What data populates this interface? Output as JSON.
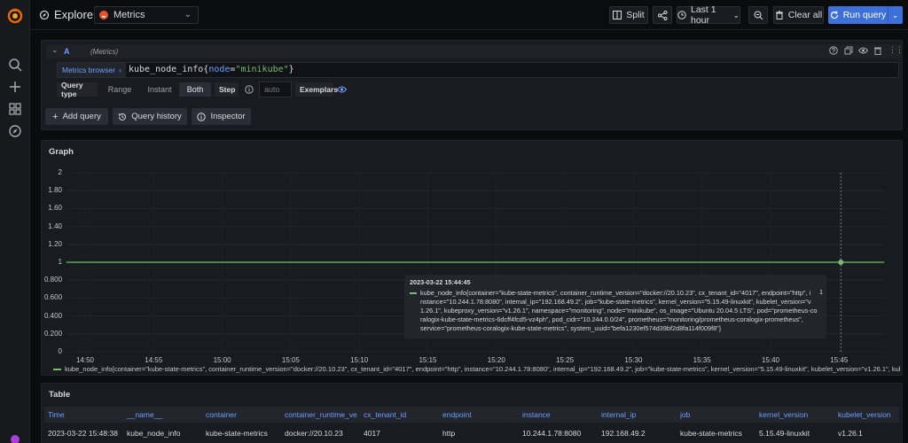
{
  "header": {
    "title": "Explore",
    "datasource": "Metrics",
    "split_label": "Split",
    "time_range": "Last 1 hour",
    "clear_all_label": "Clear all",
    "run_query_label": "Run query"
  },
  "query": {
    "ref": "A",
    "datasource_tag": "(Metrics)",
    "metrics_browser": "Metrics browser",
    "expr_metric": "kube_node_info",
    "expr_open": "{",
    "expr_label": "node",
    "expr_op": "=",
    "expr_value": "\"minikube\"",
    "expr_close": "}",
    "query_type_label": "Query type",
    "query_types": [
      "Range",
      "Instant",
      "Both"
    ],
    "selected_query_type": "Both",
    "step_label": "Step",
    "step_placeholder": "auto",
    "exemplars_label": "Exemplars"
  },
  "actions": {
    "add_query": "Add query",
    "query_history": "Query history",
    "inspector": "Inspector"
  },
  "graph": {
    "title": "Graph",
    "tooltip_time": "2023-03-22 15:44:45",
    "tooltip_line1": "kube_node_info{container=\"kube-state-metrics\", container_runtime_version=\"docker://20.10.23\", cx_tenant_id=\"4017\", endpoint=\"http\", i",
    "tooltip_line2": "nstance=\"10.244.1.78:8080\", internal_ip=\"192.168.49.2\", job=\"kube-state-metrics\", kernel_version=\"5.15.49-linuxkit\", kubelet_version=\"v",
    "tooltip_line3": "1.26.1\", kubeproxy_version=\"v1.26.1\", namespace=\"monitoring\", node=\"minikube\", os_image=\"Ubuntu 20.04.5 LTS\", pod=\"prometheus-co",
    "tooltip_line4": "ralogix-kube-state-metrics-6dcff4fcd5-vz4ph\", pod_cidr=\"10.244.0.0/24\", prometheus=\"monitoring/prometheus-coralogix-prometheus\",",
    "tooltip_line5": "service=\"prometheus-coralogix-kube-state-metrics\", system_uuid=\"befa1230ef574d39bf2d8fa114f009f8\"}",
    "tooltip_value": "1",
    "legend": "kube_node_info{container=\"kube-state-metrics\", container_runtime_version=\"docker://20.10.23\", cx_tenant_id=\"4017\", endpoint=\"http\", instance=\"10.244.1.78:8080\", internal_ip=\"192.168.49.2\", job=\"kube-state-metrics\", kernel_version=\"5.15.49-linuxkit\", kubelet_version=\"v1.26.1\", kubeproxy_version=\"v"
  },
  "chart_data": {
    "type": "line",
    "x": [
      "14:50",
      "14:55",
      "15:00",
      "15:05",
      "15:10",
      "15:15",
      "15:20",
      "15:25",
      "15:30",
      "15:35",
      "15:40",
      "15:45"
    ],
    "y_ticks": [
      "2",
      "1.80",
      "1.60",
      "1.40",
      "1.20",
      "1",
      "0.800",
      "0.600",
      "0.400",
      "0.200",
      "0"
    ],
    "ylim": [
      0,
      2
    ],
    "series": [
      {
        "name": "kube_node_info{container=\"kube-state-metrics\", ...}",
        "values": [
          1,
          1,
          1,
          1,
          1,
          1,
          1,
          1,
          1,
          1,
          1,
          1
        ],
        "color": "#73bf69"
      }
    ]
  },
  "table": {
    "title": "Table",
    "columns": [
      "Time",
      "__name__",
      "container",
      "container_runtime_ve",
      "cx_tenant_id",
      "endpoint",
      "instance",
      "internal_ip",
      "job",
      "kernel_version",
      "kubelet_version"
    ],
    "rows": [
      [
        "2023-03-22 15:48:38",
        "kube_node_info",
        "kube-state-metrics",
        "docker://20.10.23",
        "4017",
        "http",
        "10.244.1.78:8080",
        "192.168.49.2",
        "kube-state-metrics",
        "5.15.49-linuxkit",
        "v1.26.1"
      ]
    ]
  },
  "colors": {
    "accent": "#3d71d9",
    "series": "#73bf69",
    "link": "#6e9fff"
  }
}
